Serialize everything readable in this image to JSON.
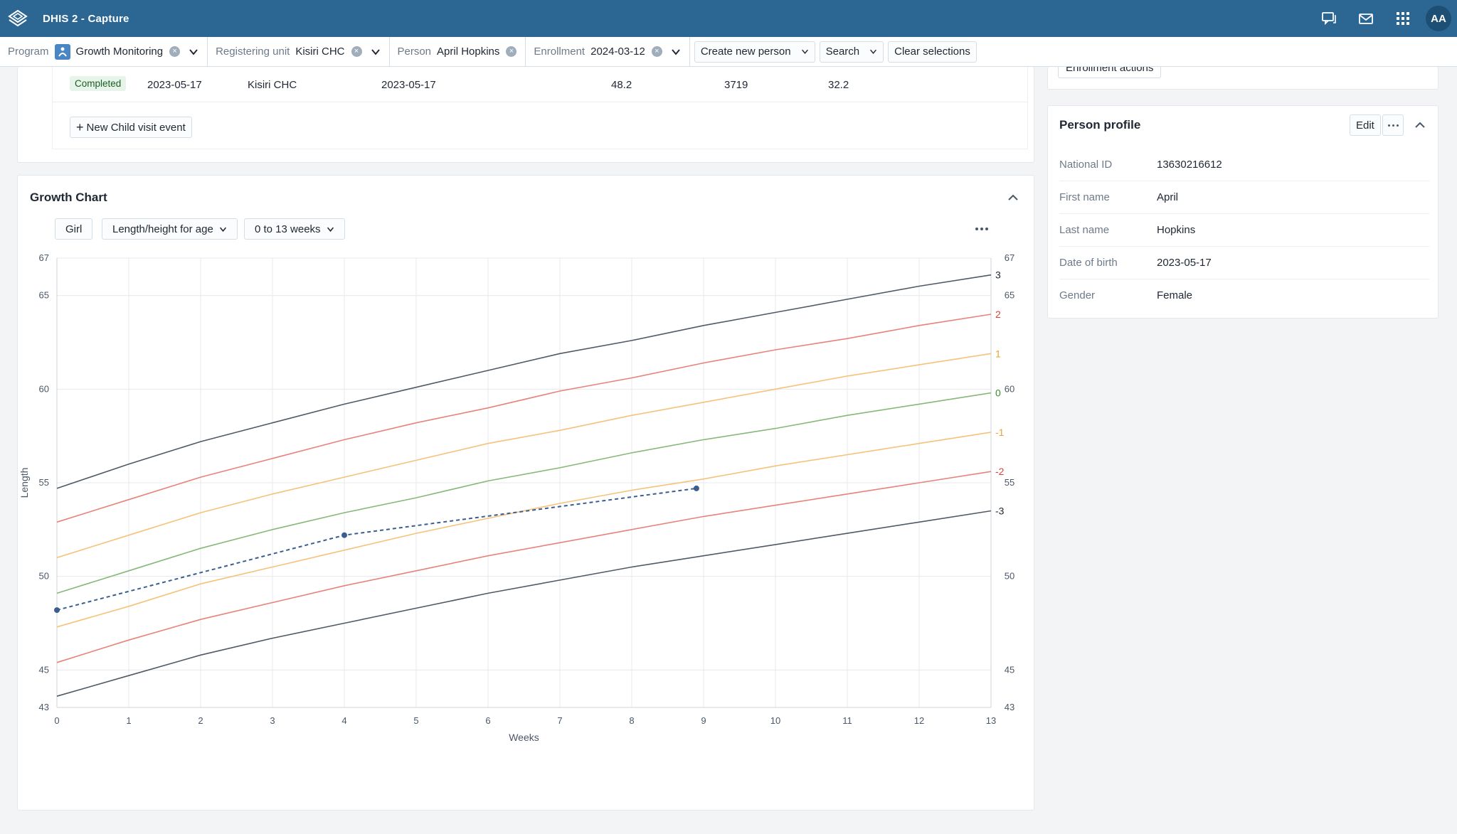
{
  "header": {
    "app_title": "DHIS 2 - Capture",
    "avatar_initials": "AA",
    "brand_color": "#2c6693"
  },
  "selection_bar": {
    "program": {
      "label": "Program",
      "value": "Growth Monitoring"
    },
    "registering_unit": {
      "label": "Registering unit",
      "value": "Kisiri CHC"
    },
    "person": {
      "label": "Person",
      "value": "April Hopkins"
    },
    "enrollment": {
      "label": "Enrollment",
      "value": "2024-03-12"
    },
    "create_new": "Create new person",
    "search": "Search",
    "clear": "Clear selections"
  },
  "events": {
    "rows": [
      {
        "status": "Completed",
        "date": "2023-05-17",
        "org_unit": "Kisiri CHC",
        "report_date": "2023-05-17",
        "v1": "48.2",
        "v2": "3719",
        "v3": "32.2"
      }
    ],
    "new_event_label": "New Child visit event"
  },
  "enrollment_widget": {
    "actions_label": "Enrollment actions"
  },
  "growth_chart": {
    "title": "Growth Chart",
    "gender_label": "Girl",
    "indicator_label": "Length/height for age",
    "range_label": "0 to 13 weeks"
  },
  "chart_data": {
    "type": "line",
    "title": "",
    "xlabel": "Weeks",
    "ylabel": "Length",
    "xlim": [
      0,
      13
    ],
    "ylim": [
      43,
      67
    ],
    "x_ticks": [
      0,
      1,
      2,
      3,
      4,
      5,
      6,
      7,
      8,
      9,
      10,
      11,
      12,
      13
    ],
    "y_ticks": [
      43,
      45,
      50,
      55,
      60,
      65,
      67
    ],
    "grid": true,
    "x": [
      0,
      1,
      2,
      3,
      4,
      5,
      6,
      7,
      8,
      9,
      10,
      11,
      12,
      13
    ],
    "series": [
      {
        "name": "3",
        "color": "#505a64",
        "values": [
          54.7,
          56.0,
          57.2,
          58.2,
          59.2,
          60.1,
          61.0,
          61.9,
          62.6,
          63.4,
          64.1,
          64.8,
          65.5,
          66.1
        ]
      },
      {
        "name": "2",
        "color": "#e8827a",
        "values": [
          52.9,
          54.1,
          55.3,
          56.3,
          57.3,
          58.2,
          59.0,
          59.9,
          60.6,
          61.4,
          62.1,
          62.7,
          63.4,
          64.0
        ]
      },
      {
        "name": "1",
        "color": "#f5c27a",
        "values": [
          51.0,
          52.2,
          53.4,
          54.4,
          55.3,
          56.2,
          57.1,
          57.8,
          58.6,
          59.3,
          60.0,
          60.7,
          61.3,
          61.9
        ]
      },
      {
        "name": "0",
        "color": "#86b878",
        "values": [
          49.1,
          50.3,
          51.5,
          52.5,
          53.4,
          54.2,
          55.1,
          55.8,
          56.6,
          57.3,
          57.9,
          58.6,
          59.2,
          59.8
        ]
      },
      {
        "name": "-1",
        "color": "#f5c27a",
        "values": [
          47.3,
          48.4,
          49.6,
          50.5,
          51.4,
          52.3,
          53.1,
          53.9,
          54.6,
          55.2,
          55.9,
          56.5,
          57.1,
          57.7
        ]
      },
      {
        "name": "-2",
        "color": "#e8827a",
        "values": [
          45.4,
          46.6,
          47.7,
          48.6,
          49.5,
          50.3,
          51.1,
          51.8,
          52.5,
          53.2,
          53.8,
          54.4,
          55.0,
          55.6
        ]
      },
      {
        "name": "-3",
        "color": "#505a64",
        "values": [
          43.6,
          44.7,
          45.8,
          46.7,
          47.5,
          48.3,
          49.1,
          49.8,
          50.5,
          51.1,
          51.7,
          52.3,
          52.9,
          53.5
        ]
      }
    ],
    "measurements": {
      "name": "",
      "color": "#3b5e8f",
      "points": [
        [
          0,
          48.2
        ],
        [
          4,
          52.2
        ],
        [
          8.9,
          54.7
        ]
      ]
    },
    "line_label_colors": {
      "3": "#212934",
      "2": "#d9443a",
      "1": "#e8a33a",
      "0": "#3f8a2f",
      "-1": "#e8a33a",
      "-2": "#d9443a",
      "-3": "#212934"
    }
  },
  "person_profile": {
    "title": "Person profile",
    "edit_label": "Edit",
    "fields": [
      {
        "label": "National ID",
        "value": "13630216612"
      },
      {
        "label": "First name",
        "value": "April"
      },
      {
        "label": "Last name",
        "value": "Hopkins"
      },
      {
        "label": "Date of birth",
        "value": "2023-05-17"
      },
      {
        "label": "Gender",
        "value": "Female"
      }
    ]
  }
}
